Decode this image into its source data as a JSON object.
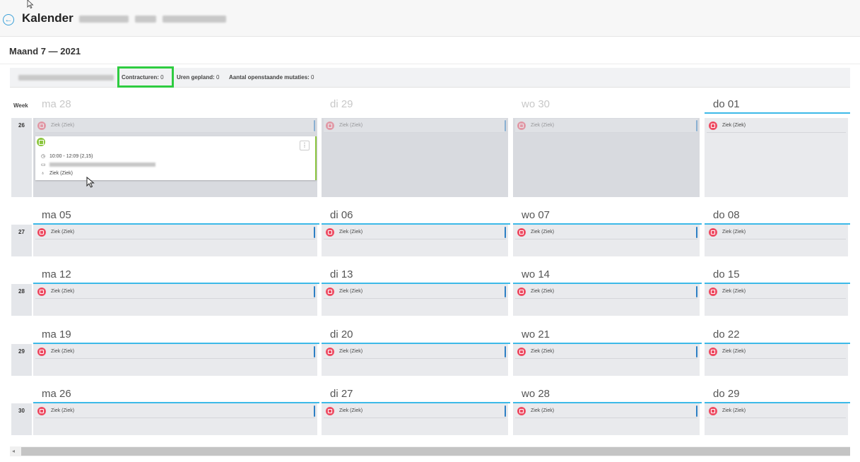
{
  "header": {
    "title": "Kalender",
    "title_suffix_redacted": true
  },
  "month": {
    "label": "Maand 7 — 2021"
  },
  "infobar": {
    "contracturen_label": "Contracturen:",
    "contracturen_value": "0",
    "uren_label": "Uren gepland:",
    "uren_value": "0",
    "mutaties_label": "Aantal openstaande mutaties:",
    "mutaties_value": "0"
  },
  "week_col_label": "Week",
  "entry_label": "Ziek (Ziek)",
  "weeks": [
    {
      "num": "26",
      "days": [
        "ma 28",
        "di 29",
        "wo 30",
        "do 01"
      ]
    },
    {
      "num": "27",
      "days": [
        "ma 05",
        "di 06",
        "wo 07",
        "do 08"
      ]
    },
    {
      "num": "28",
      "days": [
        "ma 12",
        "di 13",
        "wo 14",
        "do 15"
      ]
    },
    {
      "num": "29",
      "days": [
        "ma 19",
        "di 20",
        "wo 21",
        "do 22"
      ]
    },
    {
      "num": "30",
      "days": [
        "ma 26",
        "di 27",
        "wo 28",
        "do 29"
      ]
    }
  ],
  "detail_card": {
    "time": "10:00 - 12:09 (2,15)",
    "type": "Ziek (Ziek)",
    "menu": "⋮"
  },
  "colors": {
    "accent": "#3cb9e8",
    "sick": "#ee4b62",
    "green": "#8cc63f",
    "highlight": "#2ecc40"
  }
}
